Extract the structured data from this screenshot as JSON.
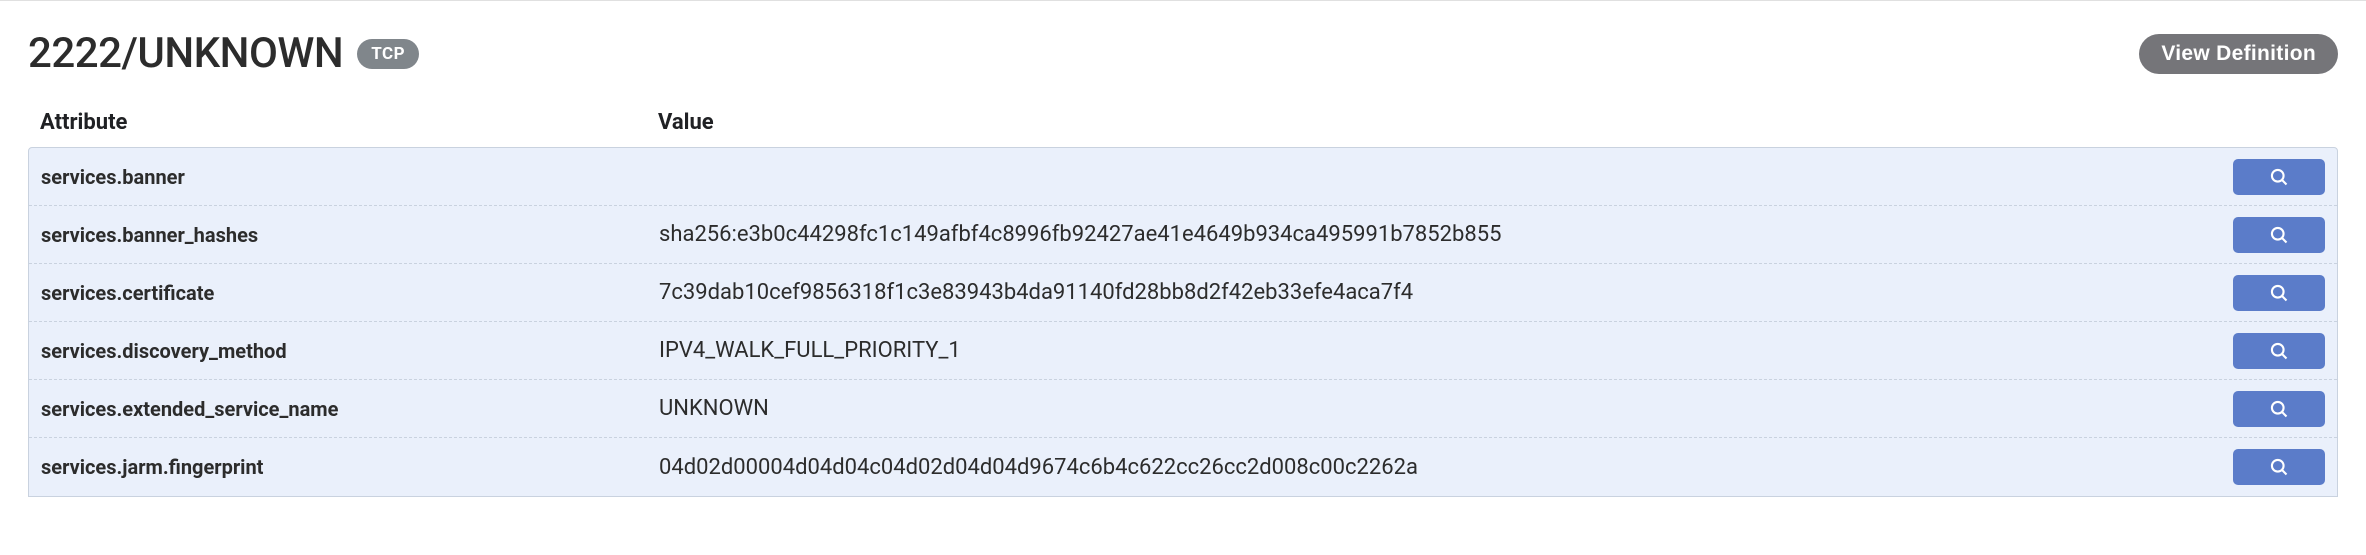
{
  "header": {
    "title": "2222/UNKNOWN",
    "protocol_badge": "TCP",
    "definition_button": "View Definition"
  },
  "table": {
    "columns": {
      "attribute": "Attribute",
      "value": "Value"
    },
    "rows": [
      {
        "attribute": "services.banner",
        "value": ""
      },
      {
        "attribute": "services.banner_hashes",
        "value": "sha256:e3b0c44298fc1c149afbf4c8996fb92427ae41e4649b934ca495991b7852b855"
      },
      {
        "attribute": "services.certificate",
        "value": "7c39dab10cef9856318f1c3e83943b4da91140fd28bb8d2f42eb33efe4aca7f4"
      },
      {
        "attribute": "services.discovery_method",
        "value": "IPV4_WALK_FULL_PRIORITY_1"
      },
      {
        "attribute": "services.extended_service_name",
        "value": "UNKNOWN"
      },
      {
        "attribute": "services.jarm.fingerprint",
        "value": "04d02d00004d04d04c04d02d04d04d9674c6b4c622cc26cc2d008c00c2262a"
      }
    ]
  },
  "icons": {
    "search": "search-icon"
  }
}
